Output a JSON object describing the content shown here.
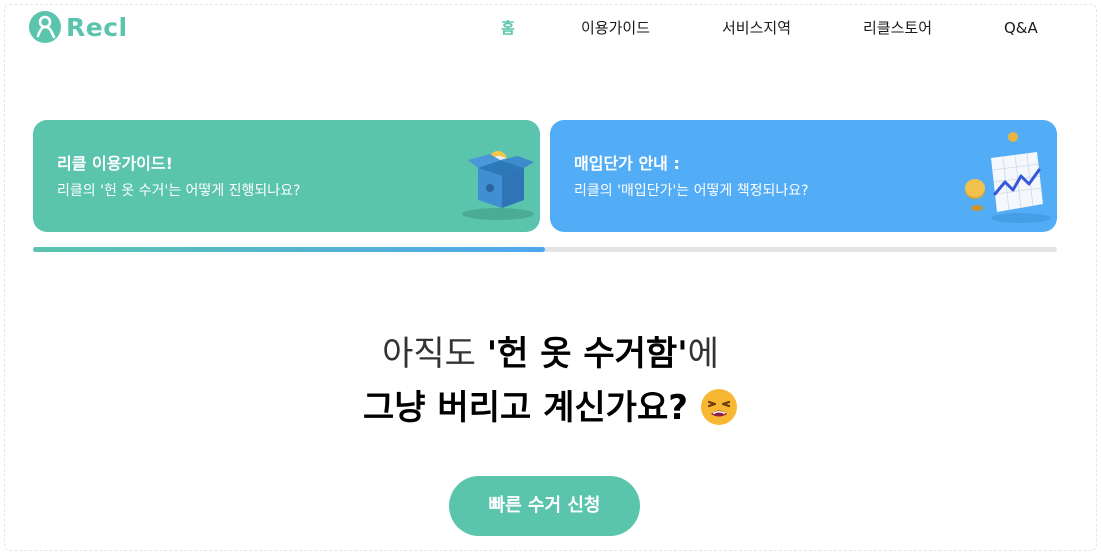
{
  "brand": {
    "name": "Recl",
    "color": "#5bc4ad",
    "logo_icon": "person-loop-icon"
  },
  "nav": {
    "items": [
      {
        "label": "홈",
        "active": true
      },
      {
        "label": "이용가이드",
        "active": false
      },
      {
        "label": "서비스지역",
        "active": false
      },
      {
        "label": "리클스토어",
        "active": false
      },
      {
        "label": "Q&A",
        "active": false
      }
    ]
  },
  "banners": [
    {
      "title": "리클 이용가이드!",
      "subtitle": "리클의 '헌 옷 수거'는 어떻게 진행되나요?",
      "color": "#5ac4ad",
      "icon": "box-icon"
    },
    {
      "title": "매입단가 안내 :",
      "subtitle": "리클의 '매입단가'는 어떻게 책정되나요?",
      "color": "#52adf6",
      "icon": "chart-coins-icon"
    }
  ],
  "slider_progress": 0.5,
  "headline": {
    "line1_prefix": "아직도 ",
    "line1_bold": "'헌 옷 수거함'",
    "line1_suffix": "에",
    "line2": "그냥 버리고 계신가요?",
    "emoji": "tired-face-emoji"
  },
  "cta": {
    "label": "빠른 수거 신청"
  }
}
